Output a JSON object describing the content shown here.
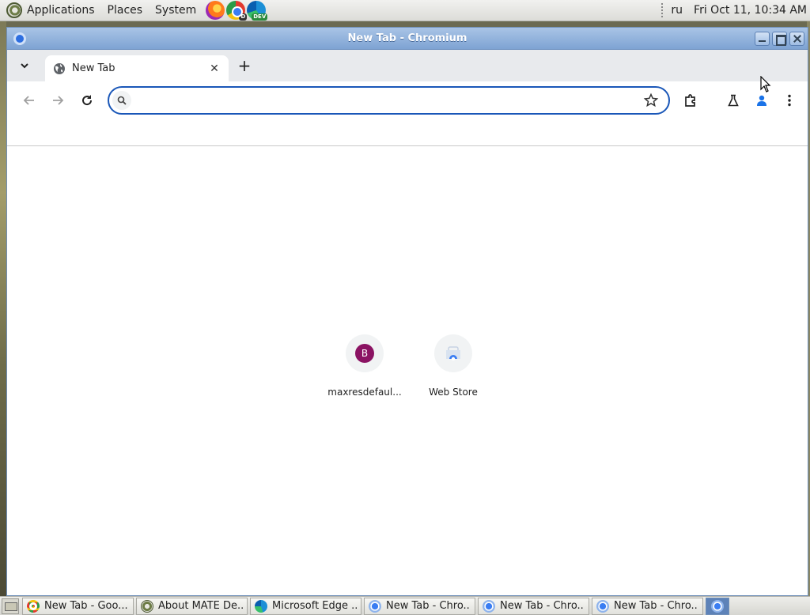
{
  "top_panel": {
    "menus": [
      "Applications",
      "Places",
      "System"
    ],
    "launchers": [
      {
        "name": "firefox-icon"
      },
      {
        "name": "chrome-dev-icon",
        "badge": "D"
      },
      {
        "name": "edge-dev-icon",
        "badge": "DEV"
      }
    ],
    "keyboard_layout": "ru",
    "clock": "Fri Oct 11, 10:34 AM"
  },
  "window": {
    "title": "New Tab - Chromium",
    "tab": {
      "title": "New Tab",
      "close": "✕"
    },
    "new_tab": "+",
    "omnibox": {
      "value": "",
      "placeholder": ""
    },
    "shortcuts": [
      {
        "letter": "B",
        "label": "maxresdefaul...",
        "color": "#8b1363"
      },
      {
        "label": "Web Store"
      }
    ]
  },
  "taskbar": {
    "tasks": [
      {
        "label": "New Tab - Goo...",
        "icon": "chrome-icon"
      },
      {
        "label": "About MATE De...",
        "icon": "mate-icon"
      },
      {
        "label": "Microsoft Edge ...",
        "icon": "edge-icon"
      },
      {
        "label": "New Tab - Chro...",
        "icon": "chromium-icon"
      },
      {
        "label": "New Tab - Chro...",
        "icon": "chromium-icon"
      },
      {
        "label": "New Tab - Chro...",
        "icon": "chromium-icon"
      }
    ]
  },
  "colors": {
    "accent": "#1a57b8",
    "titlebar": "#7ea3d3",
    "profile": "#1a73e8"
  }
}
